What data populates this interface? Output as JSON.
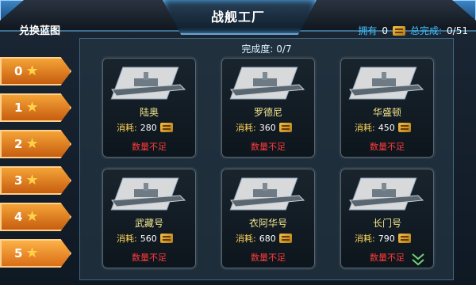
{
  "header": {
    "title": "战舰工厂"
  },
  "sidebar": {
    "title": "兑换蓝图",
    "filters": [
      {
        "label": "0"
      },
      {
        "label": "1"
      },
      {
        "label": "2"
      },
      {
        "label": "3"
      },
      {
        "label": "4"
      },
      {
        "label": "5"
      }
    ]
  },
  "stats": {
    "owned_label": "拥有",
    "owned_value": "0",
    "total_label": "总完成:",
    "total_value": "0/51"
  },
  "panel": {
    "progress": "完成度: 0/7",
    "cost_label": "消耗:",
    "insufficient_text": "数量不足",
    "ships": [
      {
        "name": "陆奥",
        "cost": "280"
      },
      {
        "name": "罗德尼",
        "cost": "360"
      },
      {
        "name": "华盛顿",
        "cost": "450"
      },
      {
        "name": "武藏号",
        "cost": "560"
      },
      {
        "name": "衣阿华号",
        "cost": "680"
      },
      {
        "name": "长门号",
        "cost": "790"
      }
    ]
  },
  "colors": {
    "accent": "#3fc0ff",
    "filter": "#e07d1d",
    "warning": "#ff3b3b",
    "ship_name": "#f0e58e"
  }
}
